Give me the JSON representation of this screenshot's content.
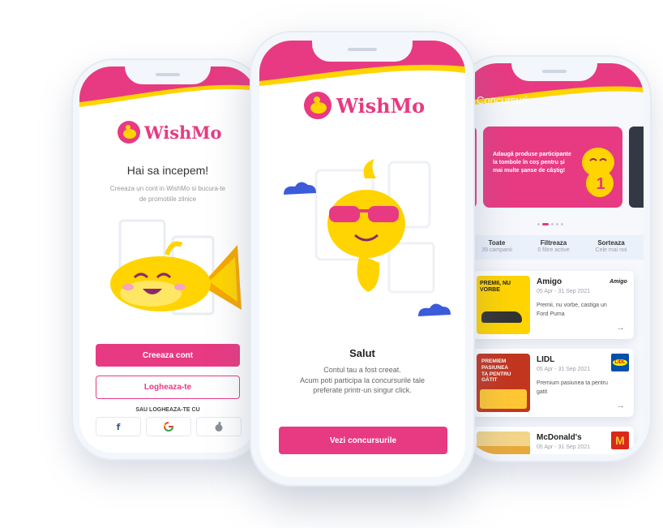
{
  "brand": {
    "name": "WishMo",
    "pink": "#e73a82",
    "yellow": "#ffd400"
  },
  "left": {
    "heading": "Hai sa incepem!",
    "subtitle": "Creeaza un cont in WishMo si bucura-te de promotiile zilnice",
    "create_button": "Creeaza cont",
    "login_button": "Logheaza-te",
    "or_login_with": "SAU LOGHEAZA-TE CU",
    "social": [
      "facebook-icon",
      "google-icon",
      "apple-icon"
    ]
  },
  "center": {
    "title": "Salut",
    "message": "Contul tau a fost creeat.\nAcum poti participa la concursurile tale preferate printr-un singur click.",
    "cta": "Vezi concursurile"
  },
  "right": {
    "header": "Concursuri",
    "banner_text": "Adaugă produse participante la tombole în coș pentru și mai multe șanse de câștig!",
    "banner_badge": "1",
    "stats": [
      {
        "title": "Toate",
        "sub": "39 campanii"
      },
      {
        "title": "Filtreaza",
        "sub": "0 filtre active"
      },
      {
        "title": "Sorteaza",
        "sub": "Cele mai noi"
      }
    ],
    "campaigns": [
      {
        "title": "Amigo",
        "date": "05 Apr - 31 Sep 2021",
        "desc": "Premii, nu vorbe, castiga un Ford Puma",
        "logo": "Amigo",
        "thumb_text": "PREMII, NU VORBE"
      },
      {
        "title": "LIDL",
        "date": "05 Apr - 31 Sep 2021",
        "desc": "Premium pasiunea ta pentru gatit",
        "logo": "LIDL",
        "thumb_text": "PREMIEM PASIUNEA TA PENTRU GĂTIT"
      },
      {
        "title": "McDonald's",
        "date": "05 Apr - 31 Sep 2021",
        "desc": "",
        "logo": "M",
        "thumb_text": ""
      }
    ]
  }
}
